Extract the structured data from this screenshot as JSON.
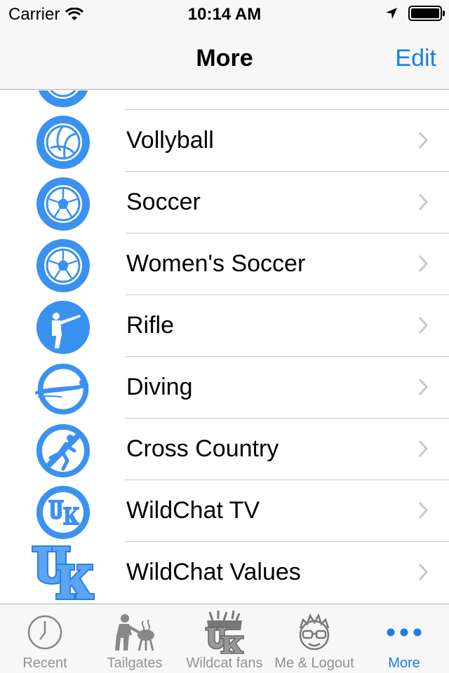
{
  "status_bar": {
    "carrier": "Carrier",
    "time": "10:14 AM"
  },
  "nav": {
    "title": "More",
    "edit_label": "Edit"
  },
  "list": {
    "items": [
      {
        "label": "",
        "icon": "volleyball-icon"
      },
      {
        "label": "Vollyball",
        "icon": "volleyball-icon"
      },
      {
        "label": "Soccer",
        "icon": "soccer-ball-icon"
      },
      {
        "label": "Women's Soccer",
        "icon": "soccer-ball-icon"
      },
      {
        "label": "Rifle",
        "icon": "rifle-shooter-icon"
      },
      {
        "label": "Diving",
        "icon": "diver-icon"
      },
      {
        "label": "Cross Country",
        "icon": "runner-icon"
      },
      {
        "label": "WildChat TV",
        "icon": "uk-logo-circle-icon"
      },
      {
        "label": "WildChat Values",
        "icon": "uk-logo-icon"
      }
    ]
  },
  "tabs": [
    {
      "label": "Recent",
      "icon": "clock-icon"
    },
    {
      "label": "Tailgates",
      "icon": "grill-icon"
    },
    {
      "label": "Wildcat fans",
      "icon": "fans-icon"
    },
    {
      "label": "Me & Logout",
      "icon": "avatar-icon"
    },
    {
      "label": "More",
      "icon": "more-dots-icon"
    }
  ],
  "colors": {
    "accent": "#1a7dec",
    "icon_blue": "#3b91f0",
    "inactive": "#929292",
    "separator": "#c8c7cc"
  }
}
